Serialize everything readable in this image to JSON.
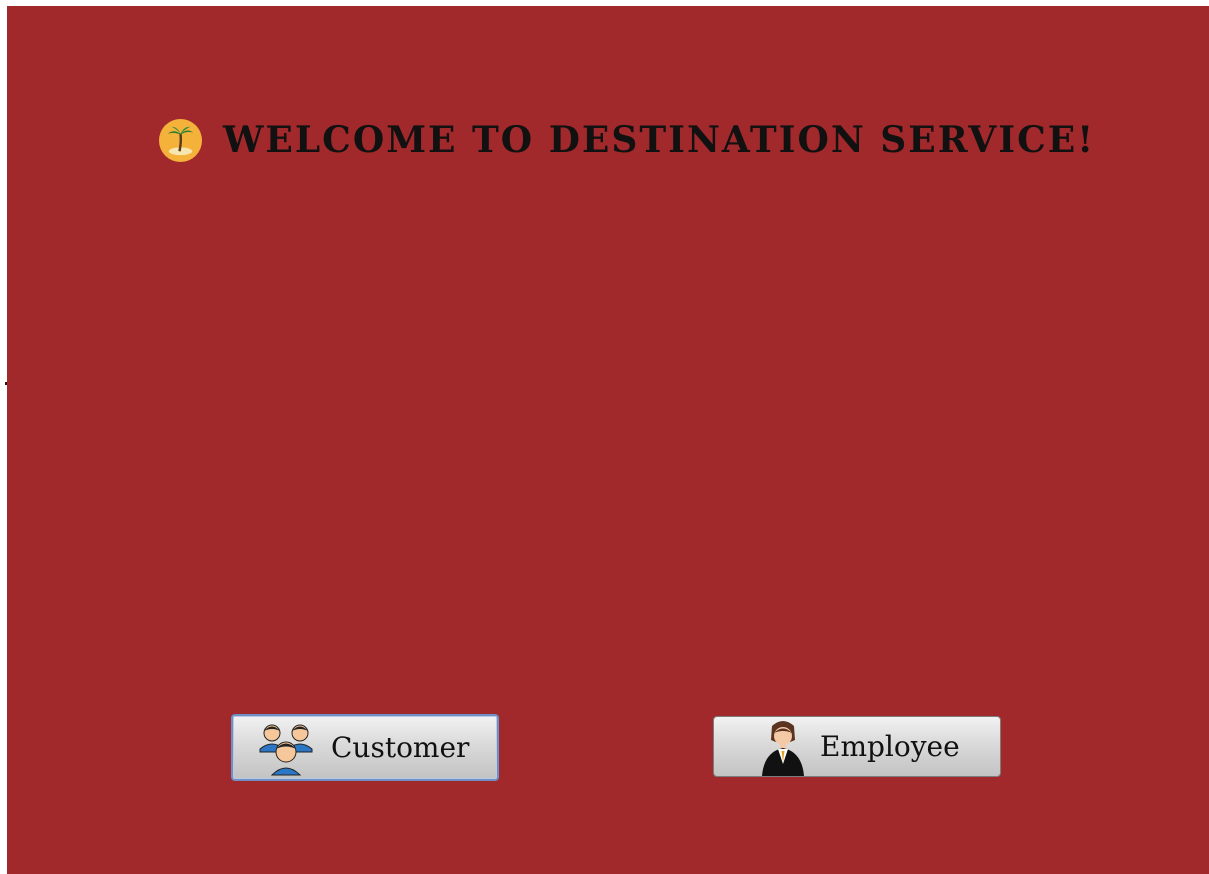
{
  "window": {
    "background_color": "#a2292b"
  },
  "header": {
    "title": "Welcome to Destination Service!",
    "icon": "palm-tree-island-icon"
  },
  "actions": {
    "customer": {
      "label": "Customer",
      "icon": "customers-group-icon",
      "focused": true
    },
    "employee": {
      "label": "Employee",
      "icon": "employee-person-icon"
    }
  }
}
